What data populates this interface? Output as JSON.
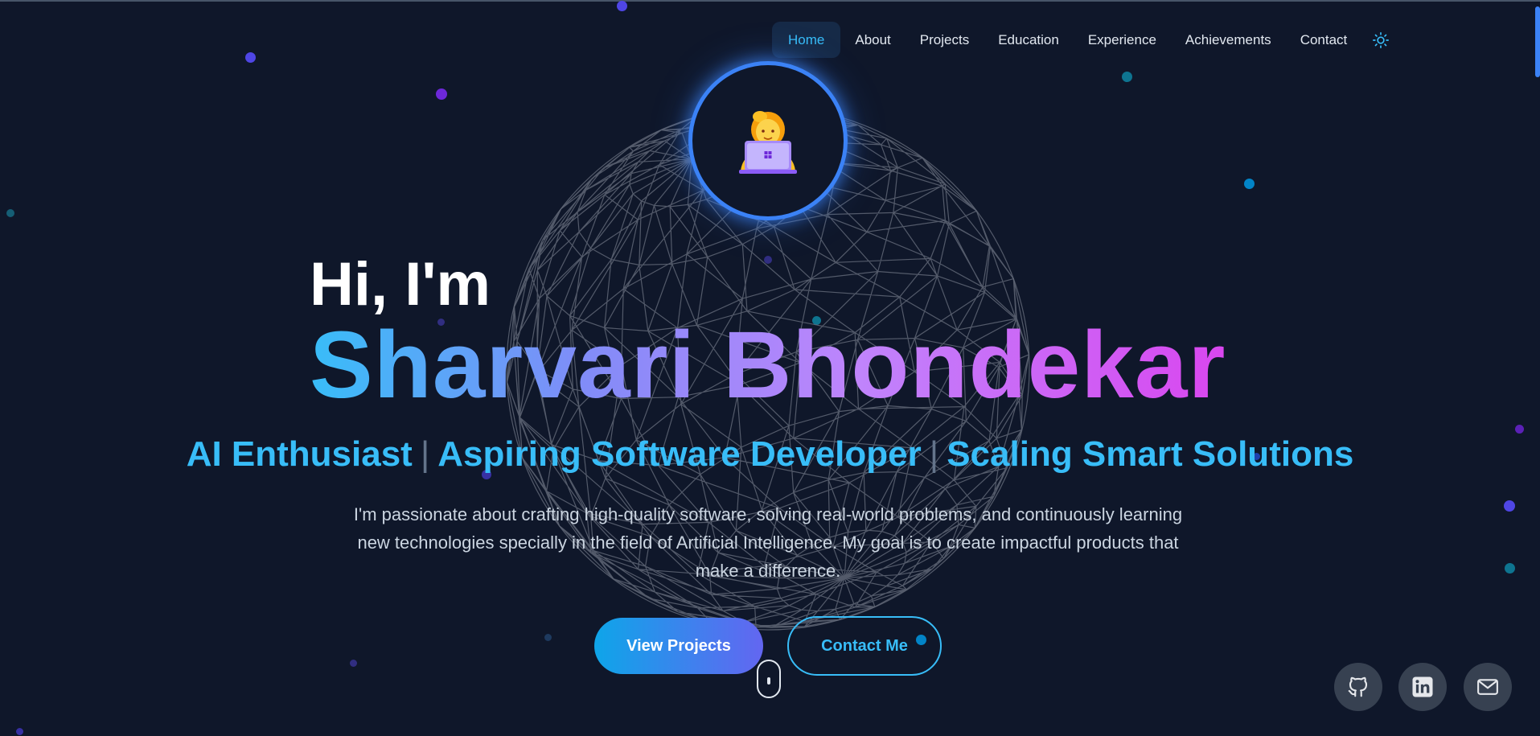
{
  "nav": {
    "items": [
      {
        "label": "Home",
        "active": true
      },
      {
        "label": "About",
        "active": false
      },
      {
        "label": "Projects",
        "active": false
      },
      {
        "label": "Education",
        "active": false
      },
      {
        "label": "Experience",
        "active": false
      },
      {
        "label": "Achievements",
        "active": false
      },
      {
        "label": "Contact",
        "active": false
      }
    ],
    "theme_toggle_icon": "sun-icon"
  },
  "hero": {
    "avatar_icon": "woman-technologist-emoji",
    "greeting": "Hi, I'm",
    "name": "Sharvari Bhondekar",
    "roles": [
      "AI Enthusiast",
      "Aspiring Software Developer",
      "Scaling Smart Solutions"
    ],
    "role_separator": "|",
    "description": "I'm passionate about crafting high-quality software, solving real-world problems, and continuously learning new technologies specially in the field of Artificial Intelligence. My goal is to create impactful products that make a difference.",
    "primary_button": "View Projects",
    "secondary_button": "Contact Me"
  },
  "social": [
    {
      "name": "github-icon"
    },
    {
      "name": "linkedin-icon"
    },
    {
      "name": "mail-icon"
    }
  ],
  "colors": {
    "background": "#0f172a",
    "accent": "#38bdf8",
    "gradient_start": "#38bdf8",
    "gradient_end": "#d946ef"
  }
}
